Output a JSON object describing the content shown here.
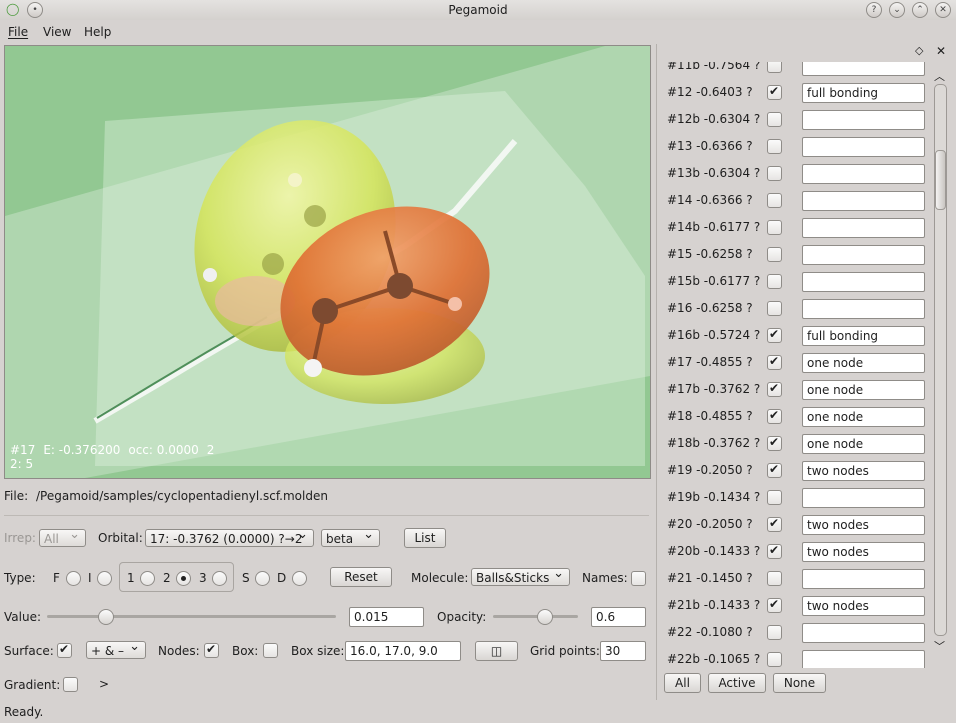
{
  "window": {
    "title": "Pegamoid"
  },
  "menu": [
    "File",
    "View",
    "Help"
  ],
  "overlay": {
    "line1_a": "#17",
    "line1_b": "E: -0.376200",
    "line1_c": "occ: 0.0000",
    "line1_d": "2",
    "line2": "2: 5"
  },
  "file": {
    "label": "File:",
    "path": "/Pegamoid/samples/cyclopentadienyl.scf.molden"
  },
  "irrep": {
    "label": "Irrep:",
    "value": "All"
  },
  "orbital": {
    "label": "Orbital:",
    "value": "17: -0.3762 (0.0000) ?→2",
    "spin": "beta",
    "list_button": "List"
  },
  "type": {
    "label": "Type:",
    "options": [
      "F",
      "I",
      "1",
      "2",
      "3",
      "S",
      "D"
    ],
    "selected": "3",
    "reset_button": "Reset"
  },
  "molecule": {
    "label": "Molecule:",
    "value": "Balls&Sticks",
    "names_label": "Names:"
  },
  "value": {
    "label": "Value:",
    "input": "0.015",
    "slider_level": 0.2
  },
  "opacity": {
    "label": "Opacity:",
    "input": "0.6",
    "slider_level": 0.6
  },
  "surface": {
    "label": "Surface:",
    "checked": true,
    "mode": "+ & –",
    "nodes_label": "Nodes:",
    "nodes_checked": true,
    "box_label": "Box:",
    "box_checked": false,
    "boxsize_label": "Box size:",
    "boxsize": "16.0, 17.0, 9.0",
    "gridpoints_label": "Grid points:",
    "gridpoints": "30"
  },
  "gradient": {
    "label": "Gradient:",
    "arrow": ">"
  },
  "status": "Ready.",
  "orbitals_panel": {
    "rows": [
      {
        "label": "#11b -0.7564 ?",
        "checked": false,
        "note": ""
      },
      {
        "label": "#12 -0.6403 ?",
        "checked": true,
        "note": "full bonding"
      },
      {
        "label": "#12b -0.6304 ?",
        "checked": false,
        "note": ""
      },
      {
        "label": "#13 -0.6366 ?",
        "checked": false,
        "note": ""
      },
      {
        "label": "#13b -0.6304 ?",
        "checked": false,
        "note": ""
      },
      {
        "label": "#14 -0.6366 ?",
        "checked": false,
        "note": ""
      },
      {
        "label": "#14b -0.6177 ?",
        "checked": false,
        "note": ""
      },
      {
        "label": "#15 -0.6258 ?",
        "checked": false,
        "note": ""
      },
      {
        "label": "#15b -0.6177 ?",
        "checked": false,
        "note": ""
      },
      {
        "label": "#16 -0.6258 ?",
        "checked": false,
        "note": ""
      },
      {
        "label": "#16b -0.5724 ?",
        "checked": true,
        "note": "full bonding"
      },
      {
        "label": "#17 -0.4855 ?",
        "checked": true,
        "note": "one node"
      },
      {
        "label": "#17b -0.3762 ?",
        "checked": true,
        "note": "one node"
      },
      {
        "label": "#18 -0.4855 ?",
        "checked": true,
        "note": "one node"
      },
      {
        "label": "#18b -0.3762 ?",
        "checked": true,
        "note": "one node"
      },
      {
        "label": "#19 -0.2050 ?",
        "checked": true,
        "note": "two nodes"
      },
      {
        "label": "#19b -0.1434 ?",
        "checked": false,
        "note": ""
      },
      {
        "label": "#20 -0.2050 ?",
        "checked": true,
        "note": "two nodes"
      },
      {
        "label": "#20b -0.1433 ?",
        "checked": true,
        "note": "two nodes"
      },
      {
        "label": "#21 -0.1450 ?",
        "checked": false,
        "note": ""
      },
      {
        "label": "#21b -0.1433 ?",
        "checked": true,
        "note": "two nodes"
      },
      {
        "label": "#22 -0.1080 ?",
        "checked": false,
        "note": ""
      },
      {
        "label": "#22b -0.1065 ?",
        "checked": false,
        "note": ""
      }
    ],
    "buttons": {
      "all": "All",
      "active": "Active",
      "none": "None"
    }
  }
}
